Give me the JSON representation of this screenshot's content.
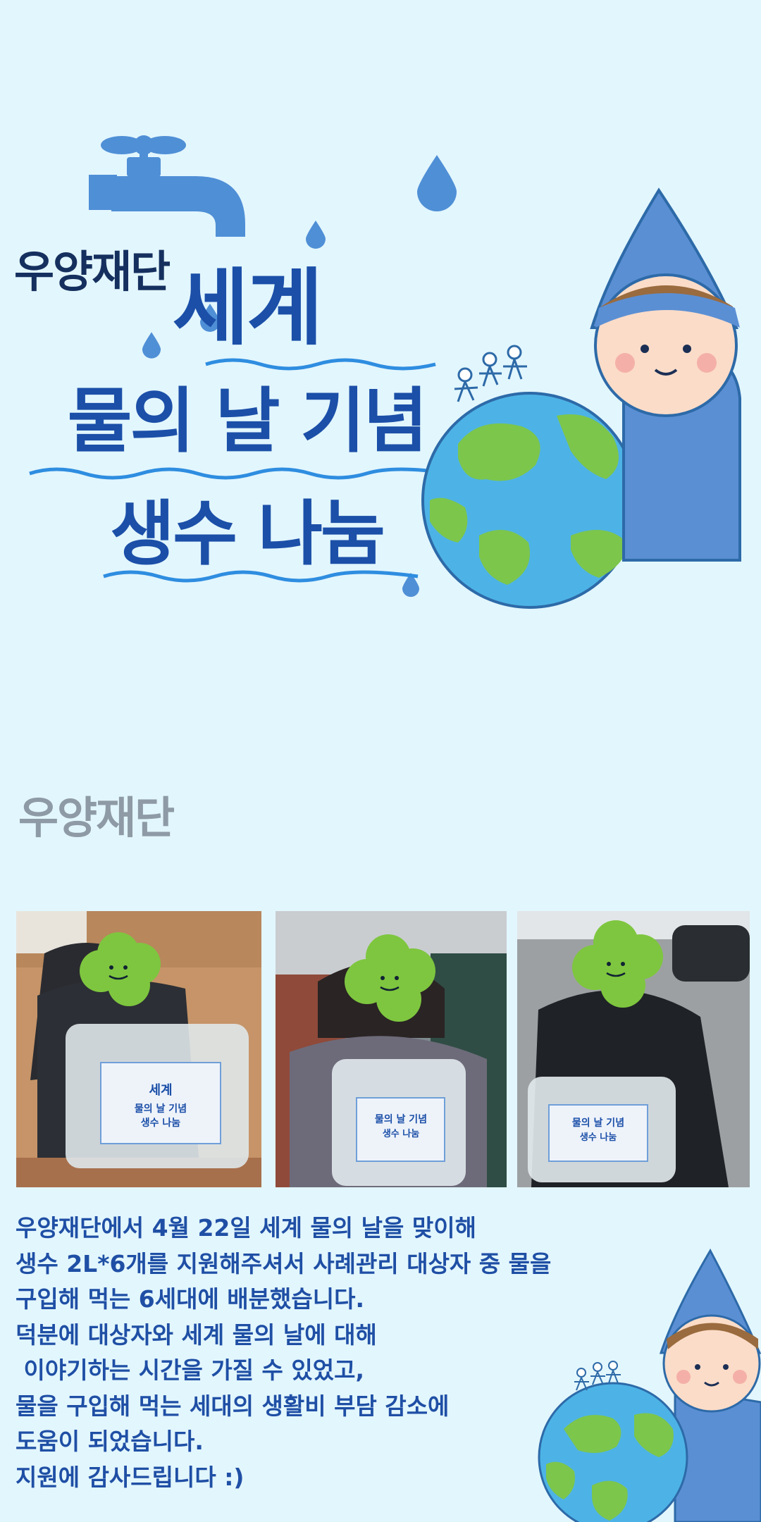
{
  "brand": {
    "logo_text": "우양재단",
    "logo_text_secondary": "우양재단"
  },
  "poster": {
    "title_line1": "세계",
    "title_line2": "물의 날 기념",
    "title_line3": "생수 나눔"
  },
  "photos": [
    {
      "label": "photo-1"
    },
    {
      "label": "photo-2"
    },
    {
      "label": "photo-3"
    }
  ],
  "message": {
    "lines": [
      "우양재단에서 4월 22일 세계 물의 날을 맞이해",
      "생수 2L*6개를 지원해주셔서 사례관리 대상자 중 물을",
      "구입해 먹는 6세대에 배분했습니다.",
      "덕분에 대상자와 세계 물의 날에 대해",
      " 이야기하는 시간을 가질 수 있었고,",
      "물을 구입해 먹는 세대의 생활비 부담 감소에",
      "도움이 되었습니다.",
      "지원에 감사드립니다 :)"
    ]
  },
  "colors": {
    "background": "#e2f6fd",
    "title_blue": "#1b4fa8",
    "accent_blue": "#4f8fd6",
    "wave_blue": "#2e8de0",
    "earth_green": "#7cc64c",
    "earth_water": "#4db3e6",
    "logo_dark": "#15305e",
    "logo_grey": "#8e9aa5",
    "mascot_hat": "#5b8fd4",
    "mascot_skin": "#fbdcc8",
    "mascot_hair": "#9a6b3e"
  },
  "icons": [
    "faucet-icon",
    "water-drop-icon",
    "earth-icon",
    "mascot-icon",
    "clover-icon"
  ]
}
